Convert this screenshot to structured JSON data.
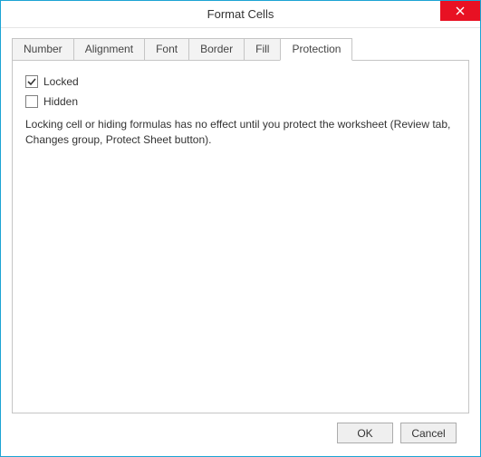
{
  "window": {
    "title": "Format Cells"
  },
  "tabs": [
    {
      "label": "Number"
    },
    {
      "label": "Alignment"
    },
    {
      "label": "Font"
    },
    {
      "label": "Border"
    },
    {
      "label": "Fill"
    },
    {
      "label": "Protection",
      "active": true
    }
  ],
  "protection": {
    "locked_label": "Locked",
    "locked_checked": true,
    "hidden_label": "Hidden",
    "hidden_checked": false,
    "description": "Locking cell or hiding formulas has no effect until you protect the worksheet (Review tab, Changes group, Protect Sheet button)."
  },
  "buttons": {
    "ok": "OK",
    "cancel": "Cancel"
  }
}
